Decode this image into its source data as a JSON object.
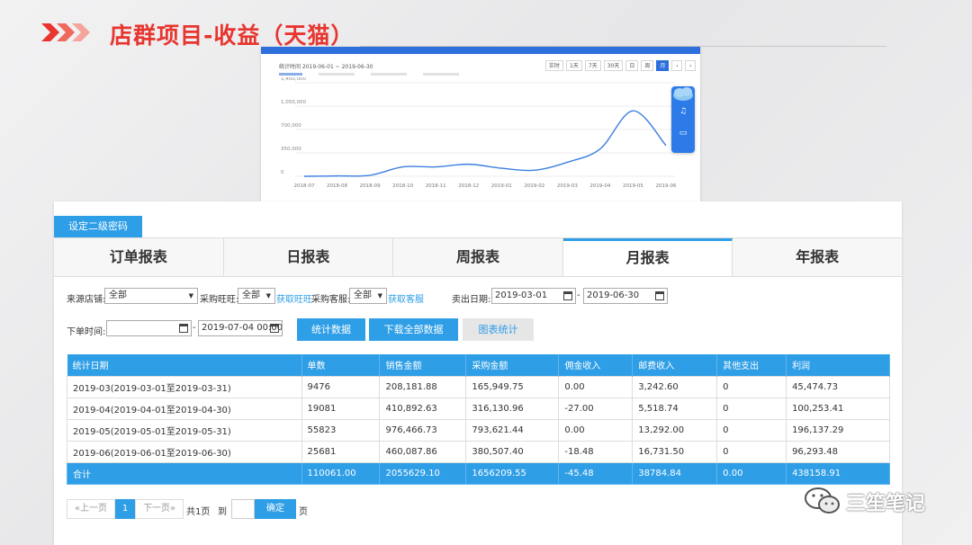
{
  "slide": {
    "title": "店群项目-收益（天猫）"
  },
  "chart_screenshot": {
    "period_text": "统计时间 2019-06-01 ~ 2019-06-30",
    "range_buttons": [
      "实时",
      "1天",
      "7天",
      "30天",
      "日",
      "周",
      "月",
      "‹",
      "›"
    ],
    "active_range": "月",
    "y_ticks": [
      "1,400,000",
      "1,050,000",
      "700,000",
      "350,000",
      "0"
    ],
    "x_ticks": [
      "2018-07",
      "2018-08",
      "2018-09",
      "2018-10",
      "2018-11",
      "2018-12",
      "2019-01",
      "2019-02",
      "2019-03",
      "2019-04",
      "2019-05",
      "2019-06"
    ],
    "line_color": "#3b7fe0"
  },
  "chart_data": {
    "type": "line",
    "x": [
      "2018-07",
      "2018-08",
      "2018-09",
      "2018-10",
      "2018-11",
      "2018-12",
      "2019-01",
      "2019-02",
      "2019-03",
      "2019-04",
      "2019-05",
      "2019-06"
    ],
    "series": [
      {
        "values": [
          0,
          5000,
          15000,
          140000,
          140000,
          180000,
          120000,
          90000,
          210000,
          410000,
          980000,
          460000
        ]
      }
    ],
    "ylim": [
      0,
      1400000
    ],
    "y_ticks": [
      0,
      350000,
      700000,
      1050000,
      1400000
    ],
    "grid": true
  },
  "toolbar": {
    "set_password": "设定二级密码"
  },
  "tabs": [
    {
      "label": "订单报表",
      "active": false
    },
    {
      "label": "日报表",
      "active": false
    },
    {
      "label": "周报表",
      "active": false
    },
    {
      "label": "月报表",
      "active": true
    },
    {
      "label": "年报表",
      "active": false
    }
  ],
  "filters": {
    "source_shop_label": "来源店铺:",
    "source_shop_value": "全部",
    "purchase_ww_label": "采购旺旺:",
    "purchase_ww_value": "全部",
    "get_ww_link": "获取旺旺",
    "purchase_cs_label": "采购客服:",
    "purchase_cs_value": "全部",
    "get_cs_link": "获取客服",
    "sold_date_label": "卖出日期:",
    "sold_date_from": "2019-03-01",
    "sold_date_to": "2019-06-30",
    "order_time_label": "下单时间:",
    "order_time_from": "",
    "order_time_to": "2019-07-04 00:00",
    "dash": "-"
  },
  "actions": {
    "stats": "统计数据",
    "download_all": "下载全部数据",
    "chart_stats": "图表统计"
  },
  "table": {
    "columns": [
      "统计日期",
      "单数",
      "销售金额",
      "采购金额",
      "佣金收入",
      "邮费收入",
      "其他支出",
      "利润"
    ],
    "rows": [
      [
        "2019-03(2019-03-01至2019-03-31)",
        "9476",
        "208,181.88",
        "165,949.75",
        "0.00",
        "3,242.60",
        "0",
        "45,474.73"
      ],
      [
        "2019-04(2019-04-01至2019-04-30)",
        "19081",
        "410,892.63",
        "316,130.96",
        "-27.00",
        "5,518.74",
        "0",
        "100,253.41"
      ],
      [
        "2019-05(2019-05-01至2019-05-31)",
        "55823",
        "976,466.73",
        "793,621.44",
        "0.00",
        "13,292.00",
        "0",
        "196,137.29"
      ],
      [
        "2019-06(2019-06-01至2019-06-30)",
        "25681",
        "460,087.86",
        "380,507.40",
        "-18.48",
        "16,731.50",
        "0",
        "96,293.48"
      ]
    ],
    "total": [
      "合计",
      "110061.00",
      "2055629.10",
      "1656209.55",
      "-45.48",
      "38784.84",
      "0.00",
      "438158.91"
    ]
  },
  "pagination": {
    "prev": "«上一页",
    "current": "1",
    "next": "下一页»",
    "total_pages": "共1页",
    "goto": "到",
    "confirm": "确定",
    "page_unit": "页"
  },
  "watermark": {
    "text": "三笙笔记"
  },
  "colors": {
    "accent_red": "#e8352f",
    "primary_blue": "#2e9ee6"
  }
}
